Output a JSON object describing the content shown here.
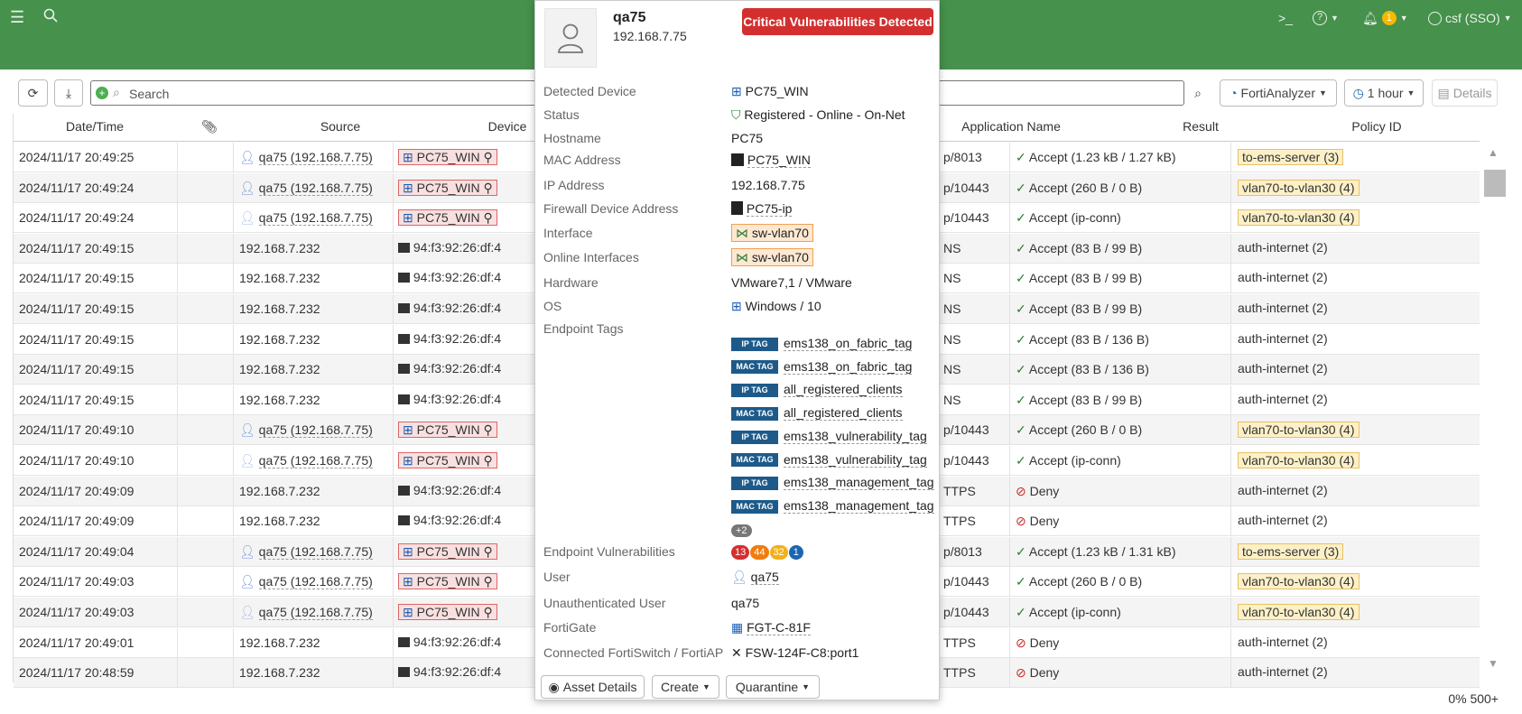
{
  "topbar": {
    "notification_count": "1",
    "user_label": "csf (SSO)"
  },
  "toolbar": {
    "search_placeholder": "Search",
    "source_label": "FortiAnalyzer",
    "time_label": "1 hour",
    "details_label": "Details"
  },
  "table": {
    "headers": [
      "Date/Time",
      "",
      "Source",
      "Device",
      "Application Name",
      "Result",
      "Policy ID"
    ],
    "rows": [
      {
        "time": "2024/11/17 20:49:25",
        "source": "qa75 (192.168.7.75)",
        "user": "filled",
        "device": "PC75_WIN",
        "app": "p/8013",
        "result": "Accept (1.23 kB / 1.27 kB)",
        "ok": true,
        "policy": "to-ems-server (3)",
        "ptag": true
      },
      {
        "time": "2024/11/17 20:49:24",
        "source": "qa75 (192.168.7.75)",
        "user": "filled",
        "device": "PC75_WIN",
        "app": "p/10443",
        "result": "Accept (260 B / 0 B)",
        "ok": true,
        "policy": "vlan70-to-vlan30 (4)",
        "ptag": true
      },
      {
        "time": "2024/11/17 20:49:24",
        "source": "qa75 (192.168.7.75)",
        "user": "outline",
        "device": "PC75_WIN",
        "app": "p/10443",
        "result": "Accept (ip-conn)",
        "ok": true,
        "policy": "vlan70-to-vlan30 (4)",
        "ptag": true
      },
      {
        "time": "2024/11/17 20:49:15",
        "source": "192.168.7.232",
        "user": "",
        "device": "94:f3:92:26:df:4",
        "app": "NS",
        "result": "Accept (83 B / 99 B)",
        "ok": true,
        "policy": "auth-internet (2)",
        "ptag": false
      },
      {
        "time": "2024/11/17 20:49:15",
        "source": "192.168.7.232",
        "user": "",
        "device": "94:f3:92:26:df:4",
        "app": "NS",
        "result": "Accept (83 B / 99 B)",
        "ok": true,
        "policy": "auth-internet (2)",
        "ptag": false
      },
      {
        "time": "2024/11/17 20:49:15",
        "source": "192.168.7.232",
        "user": "",
        "device": "94:f3:92:26:df:4",
        "app": "NS",
        "result": "Accept (83 B / 99 B)",
        "ok": true,
        "policy": "auth-internet (2)",
        "ptag": false
      },
      {
        "time": "2024/11/17 20:49:15",
        "source": "192.168.7.232",
        "user": "",
        "device": "94:f3:92:26:df:4",
        "app": "NS",
        "result": "Accept (83 B / 136 B)",
        "ok": true,
        "policy": "auth-internet (2)",
        "ptag": false
      },
      {
        "time": "2024/11/17 20:49:15",
        "source": "192.168.7.232",
        "user": "",
        "device": "94:f3:92:26:df:4",
        "app": "NS",
        "result": "Accept (83 B / 136 B)",
        "ok": true,
        "policy": "auth-internet (2)",
        "ptag": false
      },
      {
        "time": "2024/11/17 20:49:15",
        "source": "192.168.7.232",
        "user": "",
        "device": "94:f3:92:26:df:4",
        "app": "NS",
        "result": "Accept (83 B / 99 B)",
        "ok": true,
        "policy": "auth-internet (2)",
        "ptag": false
      },
      {
        "time": "2024/11/17 20:49:10",
        "source": "qa75 (192.168.7.75)",
        "user": "filled",
        "device": "PC75_WIN",
        "app": "p/10443",
        "result": "Accept (260 B / 0 B)",
        "ok": true,
        "policy": "vlan70-to-vlan30 (4)",
        "ptag": true
      },
      {
        "time": "2024/11/17 20:49:10",
        "source": "qa75 (192.168.7.75)",
        "user": "outline",
        "device": "PC75_WIN",
        "app": "p/10443",
        "result": "Accept (ip-conn)",
        "ok": true,
        "policy": "vlan70-to-vlan30 (4)",
        "ptag": true
      },
      {
        "time": "2024/11/17 20:49:09",
        "source": "192.168.7.232",
        "user": "",
        "device": "94:f3:92:26:df:4",
        "app": "TTPS",
        "result": "Deny",
        "ok": false,
        "policy": "auth-internet (2)",
        "ptag": false
      },
      {
        "time": "2024/11/17 20:49:09",
        "source": "192.168.7.232",
        "user": "",
        "device": "94:f3:92:26:df:4",
        "app": "TTPS",
        "result": "Deny",
        "ok": false,
        "policy": "auth-internet (2)",
        "ptag": false
      },
      {
        "time": "2024/11/17 20:49:04",
        "source": "qa75 (192.168.7.75)",
        "user": "filled",
        "device": "PC75_WIN",
        "app": "p/8013",
        "result": "Accept (1.23 kB / 1.31 kB)",
        "ok": true,
        "policy": "to-ems-server (3)",
        "ptag": true
      },
      {
        "time": "2024/11/17 20:49:03",
        "source": "qa75 (192.168.7.75)",
        "user": "filled",
        "device": "PC75_WIN",
        "app": "p/10443",
        "result": "Accept (260 B / 0 B)",
        "ok": true,
        "policy": "vlan70-to-vlan30 (4)",
        "ptag": true
      },
      {
        "time": "2024/11/17 20:49:03",
        "source": "qa75 (192.168.7.75)",
        "user": "outline",
        "device": "PC75_WIN",
        "app": "p/10443",
        "result": "Accept (ip-conn)",
        "ok": true,
        "policy": "vlan70-to-vlan30 (4)",
        "ptag": true
      },
      {
        "time": "2024/11/17 20:49:01",
        "source": "192.168.7.232",
        "user": "",
        "device": "94:f3:92:26:df:4",
        "app": "TTPS",
        "result": "Deny",
        "ok": false,
        "policy": "auth-internet (2)",
        "ptag": false
      },
      {
        "time": "2024/11/17 20:48:59",
        "source": "192.168.7.232",
        "user": "",
        "device": "94:f3:92:26:df:4",
        "app": "TTPS",
        "result": "Deny",
        "ok": false,
        "policy": "auth-internet (2)",
        "ptag": false
      }
    ]
  },
  "footer": {
    "progress_label": "0% 500+"
  },
  "popup": {
    "name": "qa75",
    "ip": "192.168.7.75",
    "alert": "Critical Vulnerabilities Detected",
    "fields": {
      "detected_device_label": "Detected Device",
      "detected_device": "PC75_WIN",
      "status_label": "Status",
      "status": "Registered - Online - On-Net",
      "hostname_label": "Hostname",
      "hostname": "PC75",
      "mac_label": "MAC Address",
      "mac": "PC75_WIN",
      "ip_label": "IP Address",
      "ip": "192.168.7.75",
      "fw_addr_label": "Firewall Device Address",
      "fw_addr": "PC75-ip",
      "interface_label": "Interface",
      "interface": "sw-vlan70",
      "online_ifaces_label": "Online Interfaces",
      "online_ifaces": "sw-vlan70",
      "hardware_label": "Hardware",
      "hardware": "VMware7,1 / VMware",
      "os_label": "OS",
      "os": "Windows / 10",
      "tags_label": "Endpoint Tags",
      "vulns_label": "Endpoint Vulnerabilities",
      "user_label": "User",
      "user": "qa75",
      "unauth_label": "Unauthenticated User",
      "unauth": "qa75",
      "fortigate_label": "FortiGate",
      "fortigate": "FGT-C-81F",
      "switch_label": "Connected FortiSwitch / FortiAP",
      "switch": "FSW-124F-C8:port1"
    },
    "tags": [
      {
        "kind": "IP TAG",
        "name": "ems138_on_fabric_tag"
      },
      {
        "kind": "MAC TAG",
        "name": "ems138_on_fabric_tag"
      },
      {
        "kind": "IP TAG",
        "name": "all_registered_clients"
      },
      {
        "kind": "MAC TAG",
        "name": "all_registered_clients"
      },
      {
        "kind": "IP TAG",
        "name": "ems138_vulnerability_tag"
      },
      {
        "kind": "MAC TAG",
        "name": "ems138_vulnerability_tag"
      },
      {
        "kind": "IP TAG",
        "name": "ems138_management_tag"
      },
      {
        "kind": "MAC TAG",
        "name": "ems138_management_tag"
      }
    ],
    "more_tags": "+2",
    "vulns": [
      {
        "count": "13",
        "color": "#d32f2f"
      },
      {
        "count": "44",
        "color": "#ef7d0d"
      },
      {
        "count": "32",
        "color": "#f2b01e"
      },
      {
        "count": "1",
        "color": "#1a66b3"
      }
    ],
    "buttons": {
      "asset": "Asset Details",
      "create": "Create",
      "quarantine": "Quarantine"
    }
  }
}
